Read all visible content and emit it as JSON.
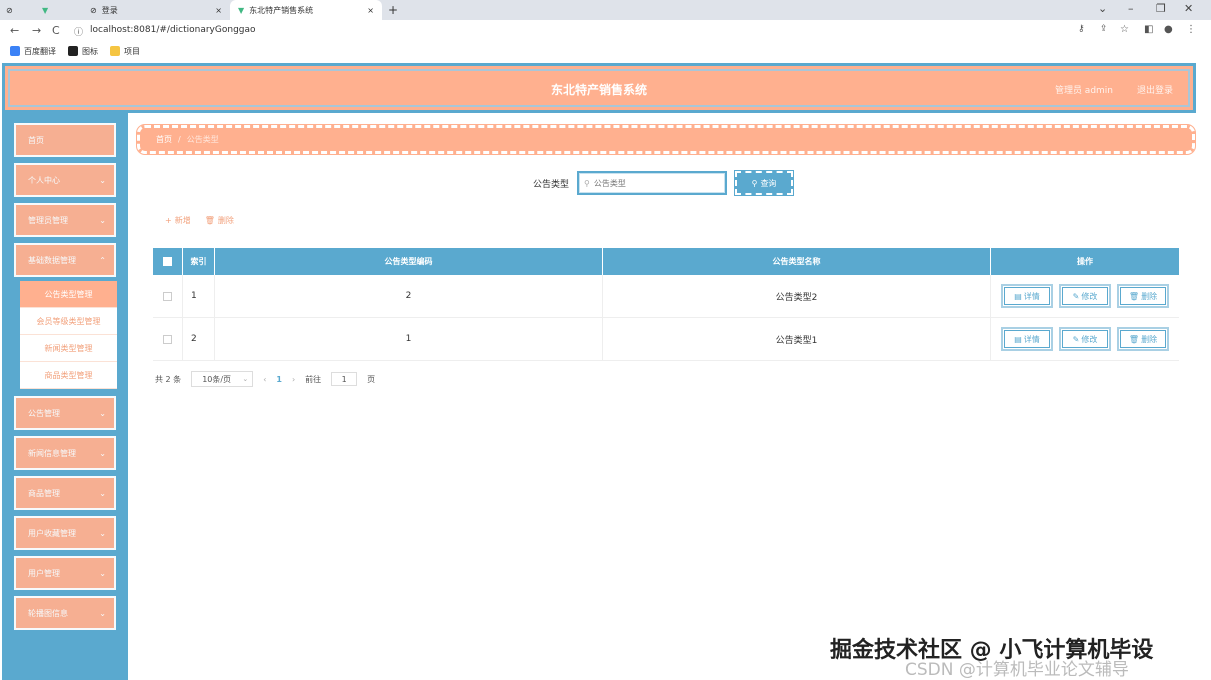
{
  "browser": {
    "tabs": [
      {
        "label": "登录"
      },
      {
        "label": "东北特产销售系统"
      }
    ],
    "url": "localhost:8081/#/dictionaryGonggao",
    "bookmarks": [
      {
        "label": "百度翻译",
        "color": "#3b82f6"
      },
      {
        "label": "图标",
        "color": "#222222"
      },
      {
        "label": "项目",
        "color": "#f5c542"
      }
    ]
  },
  "header": {
    "title": "东北特产销售系统",
    "user": "管理员 admin",
    "logout": "退出登录"
  },
  "sidebar": {
    "items": [
      {
        "label": "首页",
        "chevron": false
      },
      {
        "label": "个人中心",
        "chevron": true
      },
      {
        "label": "管理员管理",
        "chevron": true
      },
      {
        "label": "基础数据管理",
        "chevron": true
      },
      {
        "label": "公告管理",
        "chevron": true
      },
      {
        "label": "新闻信息管理",
        "chevron": true
      },
      {
        "label": "商品管理",
        "chevron": true
      },
      {
        "label": "用户收藏管理",
        "chevron": true
      },
      {
        "label": "用户管理",
        "chevron": true
      },
      {
        "label": "轮播图信息",
        "chevron": true
      }
    ],
    "submenu": [
      {
        "label": "公告类型管理",
        "active": true
      },
      {
        "label": "会员等级类型管理",
        "active": false
      },
      {
        "label": "新闻类型管理",
        "active": false
      },
      {
        "label": "商品类型管理",
        "active": false
      }
    ]
  },
  "breadcrumb": {
    "home": "首页",
    "current": "公告类型"
  },
  "search": {
    "label": "公告类型",
    "placeholder": "公告类型",
    "button": "查询"
  },
  "actions": {
    "add": "新增",
    "delete": "删除"
  },
  "table": {
    "headers": {
      "index": "索引",
      "code": "公告类型编码",
      "name": "公告类型名称",
      "op": "操作"
    },
    "rows": [
      {
        "index": "1",
        "code": "2",
        "name": "公告类型2"
      },
      {
        "index": "2",
        "code": "1",
        "name": "公告类型1"
      }
    ],
    "ops": {
      "detail": "详情",
      "edit": "修改",
      "delete": "删除"
    }
  },
  "pager": {
    "total": "共 2 条",
    "size": "10条/页",
    "current": "1",
    "goto": "前往",
    "page_input": "1",
    "page_unit": "页"
  },
  "watermark": {
    "line1": "掘金技术社区 @ 小飞计算机毕设",
    "line2": "CSDN @计算机毕业论文辅导"
  },
  "colors": {
    "primary": "#5aa9cf",
    "accent": "#ffb08f"
  }
}
